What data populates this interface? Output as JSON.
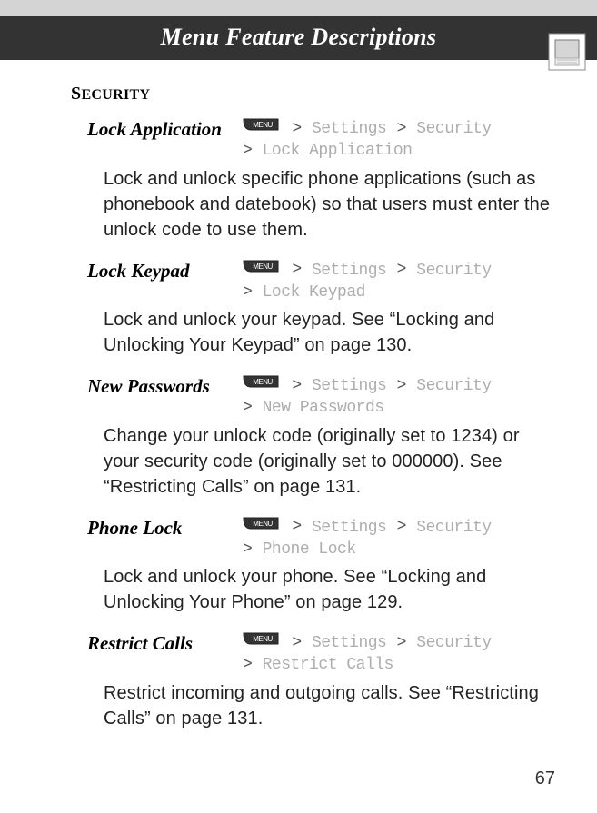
{
  "header": {
    "title": "Menu Feature Descriptions"
  },
  "section": {
    "title_first": "S",
    "title_rest": "ECURITY"
  },
  "menu_key_label": "MENU",
  "nav_common": {
    "gt": ">",
    "settings": "Settings",
    "security": "Security"
  },
  "items": [
    {
      "title": "Lock Application",
      "sub": "Lock Application",
      "desc": "Lock and unlock specific phone applications (such as phonebook and datebook) so that users must enter the unlock code to use them."
    },
    {
      "title": "Lock Keypad",
      "sub": "Lock Keypad",
      "desc": "Lock and unlock your keypad. See “Locking and Unlocking Your Keypad” on page 130."
    },
    {
      "title": "New Passwords",
      "sub": "New Passwords",
      "desc": "Change your unlock code (originally set to 1234) or your security code (originally set to 000000). See “Restricting Calls” on page 131."
    },
    {
      "title": "Phone Lock",
      "sub": "Phone Lock",
      "desc": "Lock and unlock your phone. See “Locking and Unlocking Your Phone” on page 129."
    },
    {
      "title": "Restrict Calls",
      "sub": "Restrict Calls",
      "desc": "Restrict incoming and outgoing calls. See “Restricting Calls” on page 131."
    }
  ],
  "page_number": "67"
}
